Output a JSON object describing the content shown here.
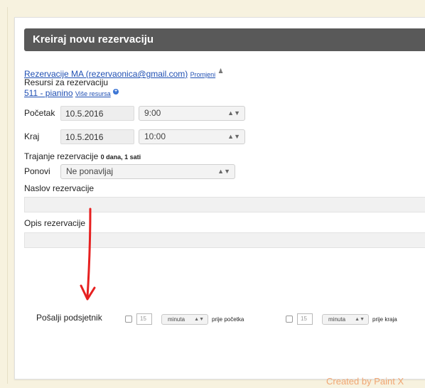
{
  "header": {
    "title": "Kreiraj novu rezervaciju"
  },
  "owner": {
    "link": "Rezervacije MA (rezervaonica@gmail.com)",
    "change_link": "Promjeni",
    "icon": "user-icon"
  },
  "resources": {
    "label": "Resursi za rezervaciju",
    "item_link": "511 - pianino",
    "more_link": "Više resursa",
    "more_icon": "plus-circle-icon"
  },
  "start": {
    "label": "Početak",
    "date": "10.5.2016",
    "time": "9:00"
  },
  "end": {
    "label": "Kraj",
    "date": "10.5.2016",
    "time": "10:00"
  },
  "duration": {
    "label": "Trajanje rezervacije",
    "value": "0 dana, 1 sati"
  },
  "repeat": {
    "label": "Ponovi",
    "value": "Ne ponavljaj"
  },
  "title_field": {
    "label": "Naslov rezervacije",
    "value": ""
  },
  "description_field": {
    "label": "Opis rezervacije",
    "value": ""
  },
  "reminder": {
    "label": "Pošalji podsjetnik",
    "before_start": {
      "placeholder": "15",
      "unit": "minuta",
      "suffix": "prije početka"
    },
    "before_end": {
      "placeholder": "15",
      "unit": "minuta",
      "suffix": "prije kraja"
    }
  },
  "annotation": {
    "arrow_color": "#e62020"
  },
  "watermark": {
    "text": "Created by Paint X"
  },
  "colors": {
    "header_bg": "#595959",
    "page_bg": "#f7f2df",
    "link": "#1f4fb3"
  }
}
